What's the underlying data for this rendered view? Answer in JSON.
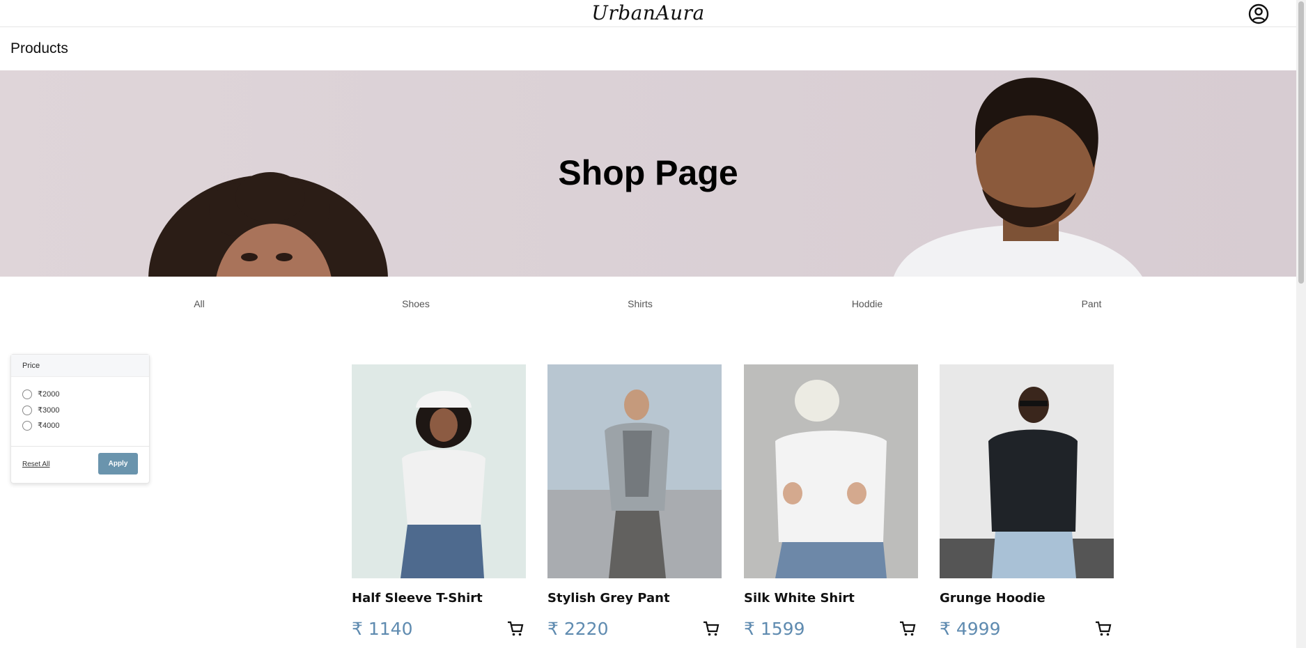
{
  "header": {
    "brand": "UrbanAura",
    "account_icon": "user-circle-icon"
  },
  "subheader": {
    "title": "Products"
  },
  "hero": {
    "heading": "Shop Page"
  },
  "categories": [
    "All",
    "Shoes",
    "Shirts",
    "Hoddie",
    "Pant"
  ],
  "filter": {
    "title": "Price",
    "options": [
      "₹2000",
      "₹3000",
      "₹4000"
    ],
    "reset_label": "Reset All",
    "apply_label": "Apply",
    "accent_color": "#6a94ad"
  },
  "products": [
    {
      "name": "Half Sleeve T-Shirt",
      "price": "₹ 1140",
      "cart_icon": "cart-icon"
    },
    {
      "name": "Stylish Grey Pant",
      "price": "₹ 2220",
      "cart_icon": "cart-icon"
    },
    {
      "name": "Silk White Shirt",
      "price": "₹ 1599",
      "cart_icon": "cart-icon"
    },
    {
      "name": "Grunge Hoodie",
      "price": "₹ 4999",
      "cart_icon": "cart-icon"
    }
  ],
  "colors": {
    "price": "#5f8bb0",
    "hero_bg": "#dcd2d7"
  }
}
